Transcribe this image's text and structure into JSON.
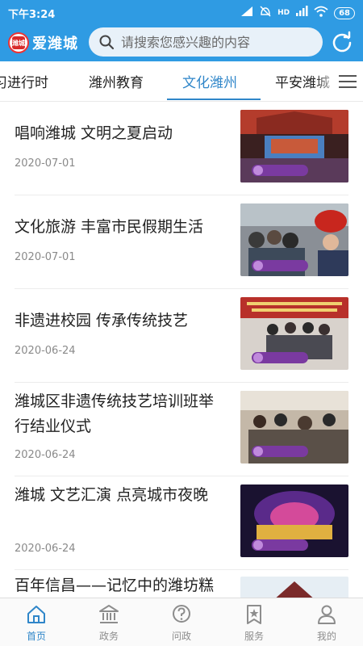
{
  "status_bar": {
    "time": "下午3:24",
    "battery": "68",
    "network": "HD"
  },
  "header": {
    "logo_text": "爱潍城",
    "logo_badge": "潍城"
  },
  "search": {
    "placeholder": "请搜索您感兴趣的内容"
  },
  "tabs": [
    {
      "label": "习进行时"
    },
    {
      "label": "潍州教育"
    },
    {
      "label": "文化潍州",
      "active": true
    },
    {
      "label": "平安潍城"
    }
  ],
  "articles": [
    {
      "title": "唱响潍城 文明之夏启动",
      "date": "2020-07-01"
    },
    {
      "title": "文化旅游 丰富市民假期生活",
      "date": "2020-07-01"
    },
    {
      "title": "非遗进校园  传承传统技艺",
      "date": "2020-06-24"
    },
    {
      "title": "潍城区非遗传统技艺培训班举行结业仪式",
      "date": "2020-06-24"
    },
    {
      "title": "潍城  文艺汇演  点亮城市夜晚",
      "date": "2020-06-24"
    },
    {
      "title": "百年信昌——记忆中的潍坊糕",
      "date": ""
    }
  ],
  "bottom_nav": [
    {
      "label": "首页",
      "icon": "home-icon",
      "active": true
    },
    {
      "label": "政务",
      "icon": "government-icon"
    },
    {
      "label": "问政",
      "icon": "question-icon"
    },
    {
      "label": "服务",
      "icon": "service-icon"
    },
    {
      "label": "我的",
      "icon": "profile-icon"
    }
  ],
  "colors": {
    "primary": "#2f9be3",
    "active_tab": "#2f86c9",
    "date_text": "#8a8a8a"
  }
}
